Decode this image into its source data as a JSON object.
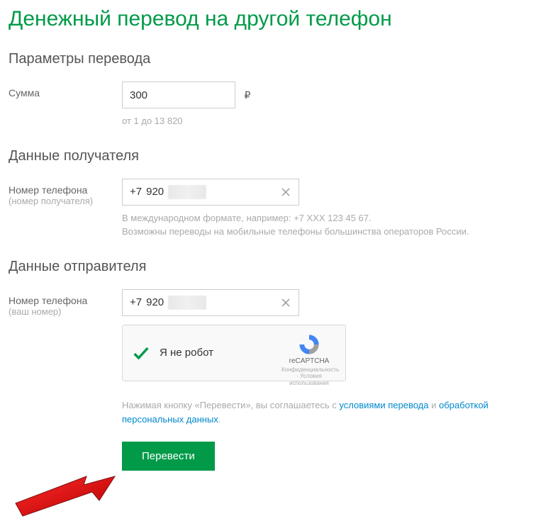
{
  "title": "Денежный перевод на другой телефон",
  "sections": {
    "params": {
      "heading": "Параметры перевода",
      "amount_label": "Сумма",
      "amount_value": "300",
      "currency": "₽",
      "amount_hint": "от 1 до 13 820"
    },
    "recipient": {
      "heading": "Данные получателя",
      "phone_label": "Номер телефона",
      "phone_sublabel": "(номер получателя)",
      "phone_prefix": "+7",
      "phone_code": "920",
      "hint_line1": "В международном формате, например: +7 XXX 123 45 67.",
      "hint_line2": "Возможны переводы на мобильные телефоны большинства операторов России."
    },
    "sender": {
      "heading": "Данные отправителя",
      "phone_label": "Номер телефона",
      "phone_sublabel": "(ваш номер)",
      "phone_prefix": "+7",
      "phone_code": "920"
    },
    "captcha": {
      "label": "Я не робот",
      "brand": "reCAPTCHA",
      "terms": "Конфиденциальность - Условия использования"
    },
    "consent": {
      "prefix": "Нажимая кнопку «Перевести», вы соглашаетесь с ",
      "link1": "условиями перевода",
      "middle": " и ",
      "link2": "обработкой персональных данных",
      "suffix": "."
    },
    "submit_label": "Перевести"
  }
}
